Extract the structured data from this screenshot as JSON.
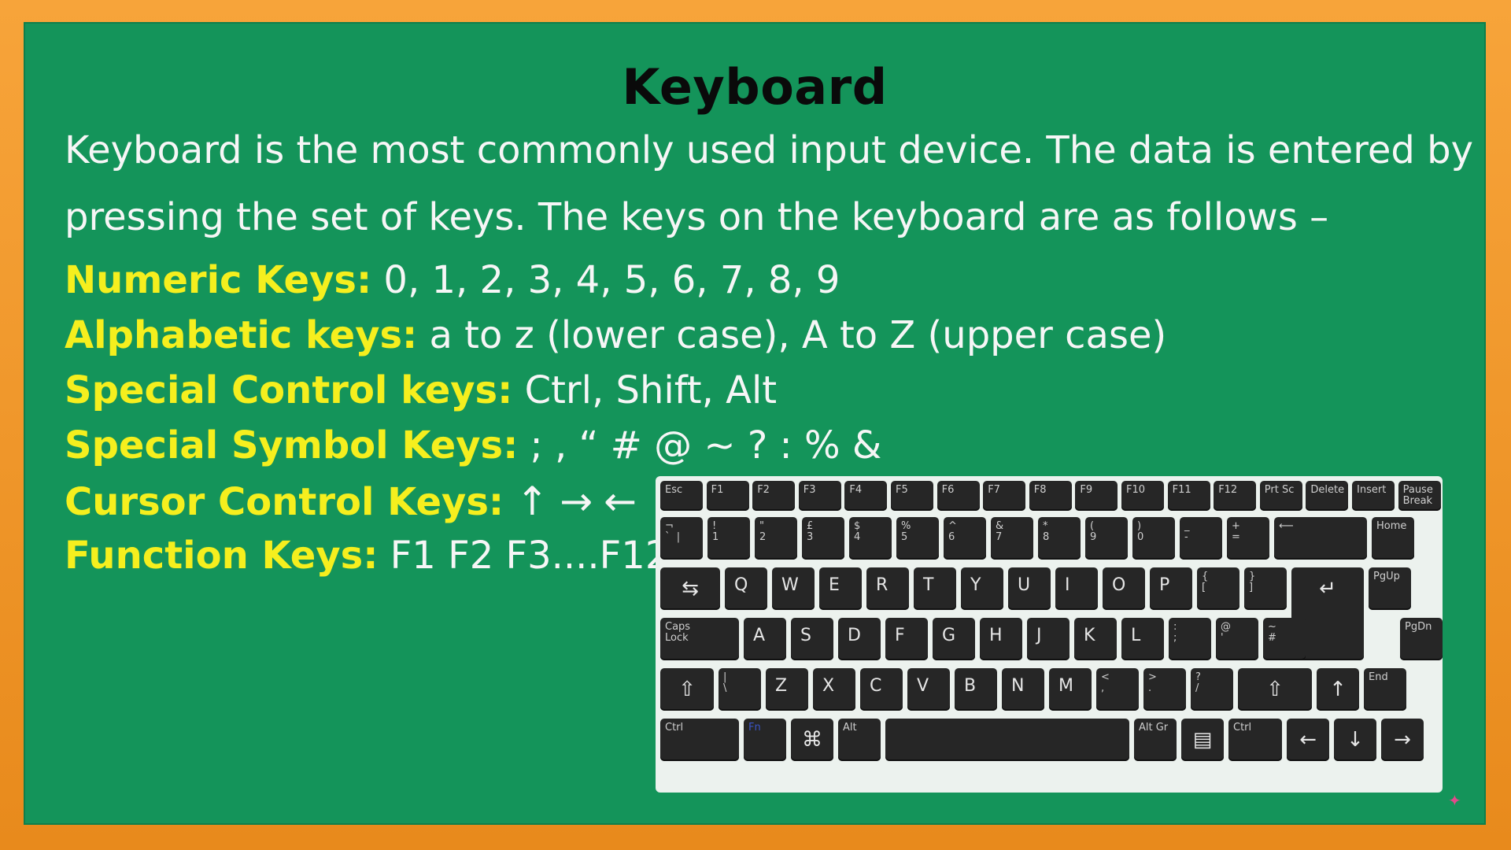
{
  "title": "Keyboard",
  "intro": {
    "line1": "Keyboard is the most commonly used input device. The data is entered by",
    "line2": "pressing the set of keys. The keys on the keyboard are as follows –"
  },
  "rows": [
    {
      "label": "Numeric Keys:",
      "value": " 0, 1, 2, 3, 4, 5, 6, 7, 8, 9"
    },
    {
      "label": "Alphabetic keys:",
      "value": " a to z (lower case), A to Z (upper case)"
    },
    {
      "label": "Special Control keys:",
      "value": " Ctrl, Shift, Alt"
    },
    {
      "label": "Special Symbol Keys:",
      "value": " ; , “ # @ ~ ? : %  &"
    },
    {
      "label": "Cursor Control Keys:",
      "arrows": [
        "↑",
        "→",
        "←",
        "↓"
      ]
    },
    {
      "label": "Function Keys:",
      "value": " F1 F2 F3....F12"
    }
  ],
  "keyboard": {
    "row_fn": [
      "Esc",
      "F1",
      "F2",
      "F3",
      "F4",
      "F5",
      "F6",
      "F7",
      "F8",
      "F9",
      "F10",
      "F11",
      "F12",
      "Prt Sc",
      "Delete",
      "Insert",
      "Pause\nBreak"
    ],
    "row_num": [
      "¬\n`  |",
      "!\n1",
      "\"\n2",
      "£\n3",
      "$\n4",
      "%\n5",
      "^\n6",
      "&\n7",
      "*\n8",
      "(\n9",
      ")\n0",
      "_\n-",
      "+\n=",
      "⟵",
      "Home"
    ],
    "row_q": [
      "⇆",
      "Q",
      "W",
      "E",
      "R",
      "T",
      "Y",
      "U",
      "I",
      "O",
      "P",
      "{\n[",
      "}\n]",
      "↵",
      "PgUp"
    ],
    "row_a": [
      "Caps\nLock",
      "A",
      "S",
      "D",
      "F",
      "G",
      "H",
      "J",
      "K",
      "L",
      ":\n;",
      "@\n'",
      "~\n#",
      "PgDn"
    ],
    "row_z": [
      "⇧",
      "|\n\\",
      "Z",
      "X",
      "C",
      "V",
      "B",
      "N",
      "M",
      "<\n,",
      ">\n.",
      "?\n/",
      "⇧",
      "↑",
      "End"
    ],
    "row_bottom": [
      "Ctrl",
      "Fn",
      "⌘",
      "Alt",
      "",
      "Alt Gr",
      "▤",
      "Ctrl",
      "←",
      "↓",
      "→"
    ]
  },
  "colors": {
    "board": "#14945a",
    "frame": "#e98a1e",
    "label": "#f5ef1e",
    "text": "#f6f6f6"
  }
}
